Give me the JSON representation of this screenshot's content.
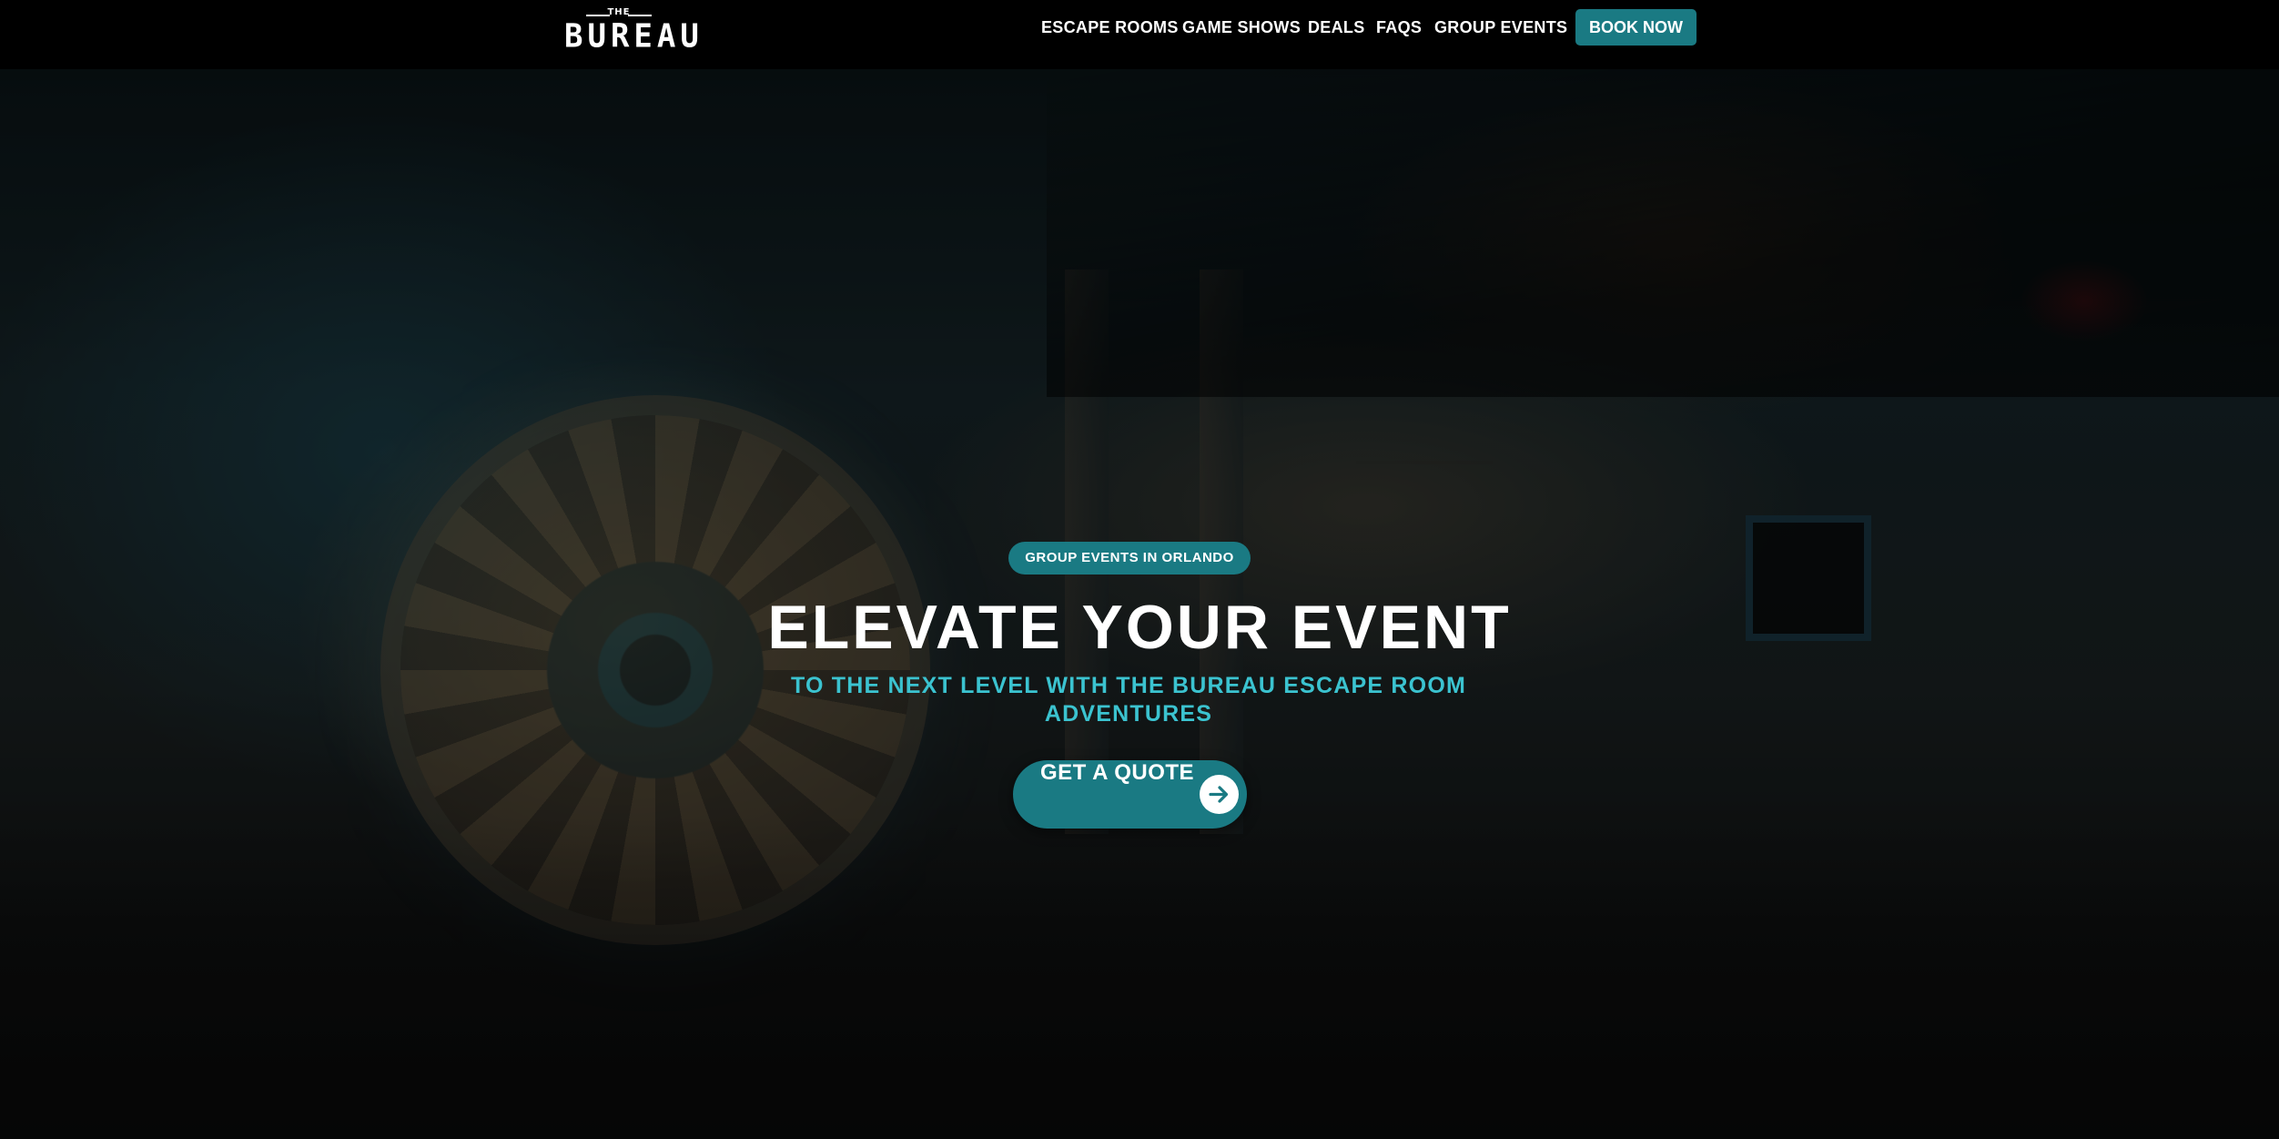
{
  "header": {
    "logo": {
      "small": "THE",
      "main": "BUREAU"
    },
    "nav": [
      {
        "label": "ESCAPE ROOMS"
      },
      {
        "label": "GAME SHOWS"
      },
      {
        "label": "DEALS"
      },
      {
        "label": "FAQS"
      },
      {
        "label": "GROUP EVENTS"
      }
    ],
    "book_label": "BOOK NOW"
  },
  "hero": {
    "eyebrow": "GROUP EVENTS IN ORLANDO",
    "headline": "ELEVATE YOUR EVENT",
    "subhead": "TO THE NEXT LEVEL WITH THE BUREAU ESCAPE ROOM ADVENTURES",
    "cta_label": "GET A QUOTE",
    "cta_icon": "arrow-right-icon",
    "background": "dimmed photo of The Bureau lobby with vault door mural"
  },
  "colors": {
    "accent": "#1a7a83",
    "subhead": "#3bc3d0",
    "header_bg": "#000000"
  }
}
